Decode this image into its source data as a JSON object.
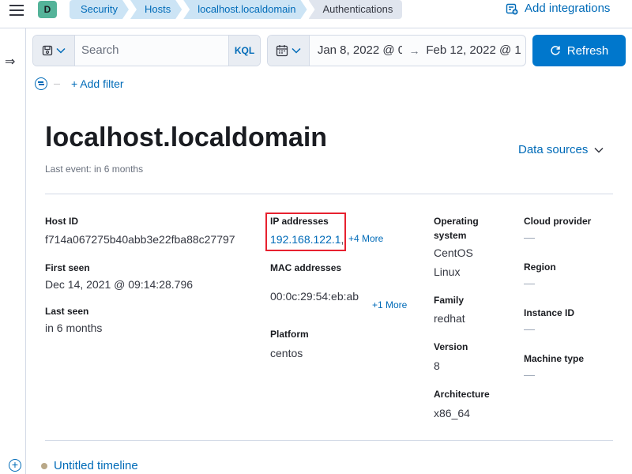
{
  "header": {
    "avatar_letter": "D",
    "breadcrumbs": [
      "Security",
      "Hosts",
      "localhost.localdomain",
      "Authentications"
    ],
    "add_integrations": "Add integrations"
  },
  "querybar": {
    "search_placeholder": "Search",
    "kql": "KQL",
    "date_start": "Jan 8, 2022 @ 0",
    "date_end": "Feb 12, 2022 @ 1",
    "refresh": "Refresh",
    "add_filter": "+ Add filter"
  },
  "host": {
    "title": "localhost.localdomain",
    "last_event": "Last event: in 6 months",
    "data_sources": "Data sources",
    "host_id_label": "Host ID",
    "host_id": "f714a067275b40abb3e22fba88c27797",
    "first_seen_label": "First seen",
    "first_seen": "Dec 14, 2021 @ 09:14:28.796",
    "last_seen_label": "Last seen",
    "last_seen": "in 6 months",
    "ip_label": "IP addresses",
    "ip": "192.168.122.1",
    "ip_more": "+4 More",
    "mac_label": "MAC addresses",
    "mac": "00:0c:29:54:eb:ab",
    "mac_more": "+1 More",
    "platform_label": "Platform",
    "platform": "centos",
    "os_label_1": "Operating",
    "os_label_2": "system",
    "os_1": "CentOS",
    "os_2": "Linux",
    "family_label": "Family",
    "family": "redhat",
    "version_label": "Version",
    "version": "8",
    "arch_label": "Architecture",
    "arch": "x86_64",
    "cloud_label": "Cloud provider",
    "cloud": "—",
    "region_label": "Region",
    "region": "—",
    "instance_label": "Instance ID",
    "instance": "—",
    "machine_label": "Machine type",
    "machine": "—"
  },
  "timeline": {
    "label": "Untitled timeline"
  }
}
